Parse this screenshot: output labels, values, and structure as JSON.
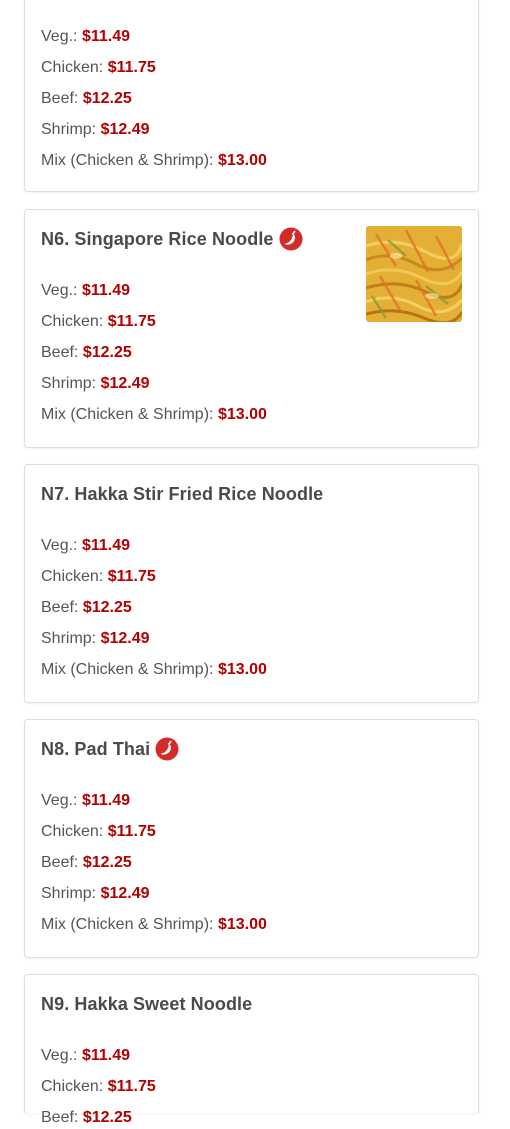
{
  "colors": {
    "price": "#b30000",
    "title": "#4a4a4a",
    "label": "#555555",
    "spicy": "#d42a2a",
    "card_border": "#dddddd"
  },
  "dishes": [
    {
      "id": "n5",
      "title": "",
      "spicy": false,
      "has_image": false,
      "prices": [
        {
          "label": "Veg.:",
          "price": "$11.49"
        },
        {
          "label": "Chicken:",
          "price": "$11.75"
        },
        {
          "label": "Beef:",
          "price": "$12.25"
        },
        {
          "label": "Shrimp:",
          "price": "$12.49"
        },
        {
          "label": "Mix (Chicken & Shrimp):",
          "price": "$13.00"
        }
      ]
    },
    {
      "id": "n6",
      "title": "N6. Singapore Rice Noodle",
      "spicy": true,
      "spicy_icon": "chili-pepper-icon",
      "has_image": true,
      "image_icon": "noodle-dish-photo",
      "prices": [
        {
          "label": "Veg.:",
          "price": "$11.49"
        },
        {
          "label": "Chicken:",
          "price": "$11.75"
        },
        {
          "label": "Beef:",
          "price": "$12.25"
        },
        {
          "label": "Shrimp:",
          "price": "$12.49"
        },
        {
          "label": "Mix (Chicken & Shrimp):",
          "price": "$13.00"
        }
      ]
    },
    {
      "id": "n7",
      "title": "N7. Hakka Stir Fried Rice Noodle",
      "spicy": false,
      "has_image": false,
      "prices": [
        {
          "label": "Veg.:",
          "price": "$11.49"
        },
        {
          "label": "Chicken:",
          "price": "$11.75"
        },
        {
          "label": "Beef:",
          "price": "$12.25"
        },
        {
          "label": "Shrimp:",
          "price": "$12.49"
        },
        {
          "label": "Mix (Chicken & Shrimp):",
          "price": "$13.00"
        }
      ]
    },
    {
      "id": "n8",
      "title": "N8. Pad Thai",
      "spicy": true,
      "spicy_icon": "chili-pepper-icon",
      "has_image": false,
      "prices": [
        {
          "label": "Veg.:",
          "price": "$11.49"
        },
        {
          "label": "Chicken:",
          "price": "$11.75"
        },
        {
          "label": "Beef:",
          "price": "$12.25"
        },
        {
          "label": "Shrimp:",
          "price": "$12.49"
        },
        {
          "label": "Mix (Chicken & Shrimp):",
          "price": "$13.00"
        }
      ]
    },
    {
      "id": "n9",
      "title": "N9. Hakka Sweet Noodle",
      "spicy": false,
      "has_image": false,
      "prices": [
        {
          "label": "Veg.:",
          "price": "$11.49"
        },
        {
          "label": "Chicken:",
          "price": "$11.75"
        },
        {
          "label": "Beef:",
          "price": "$12.25"
        }
      ]
    }
  ]
}
